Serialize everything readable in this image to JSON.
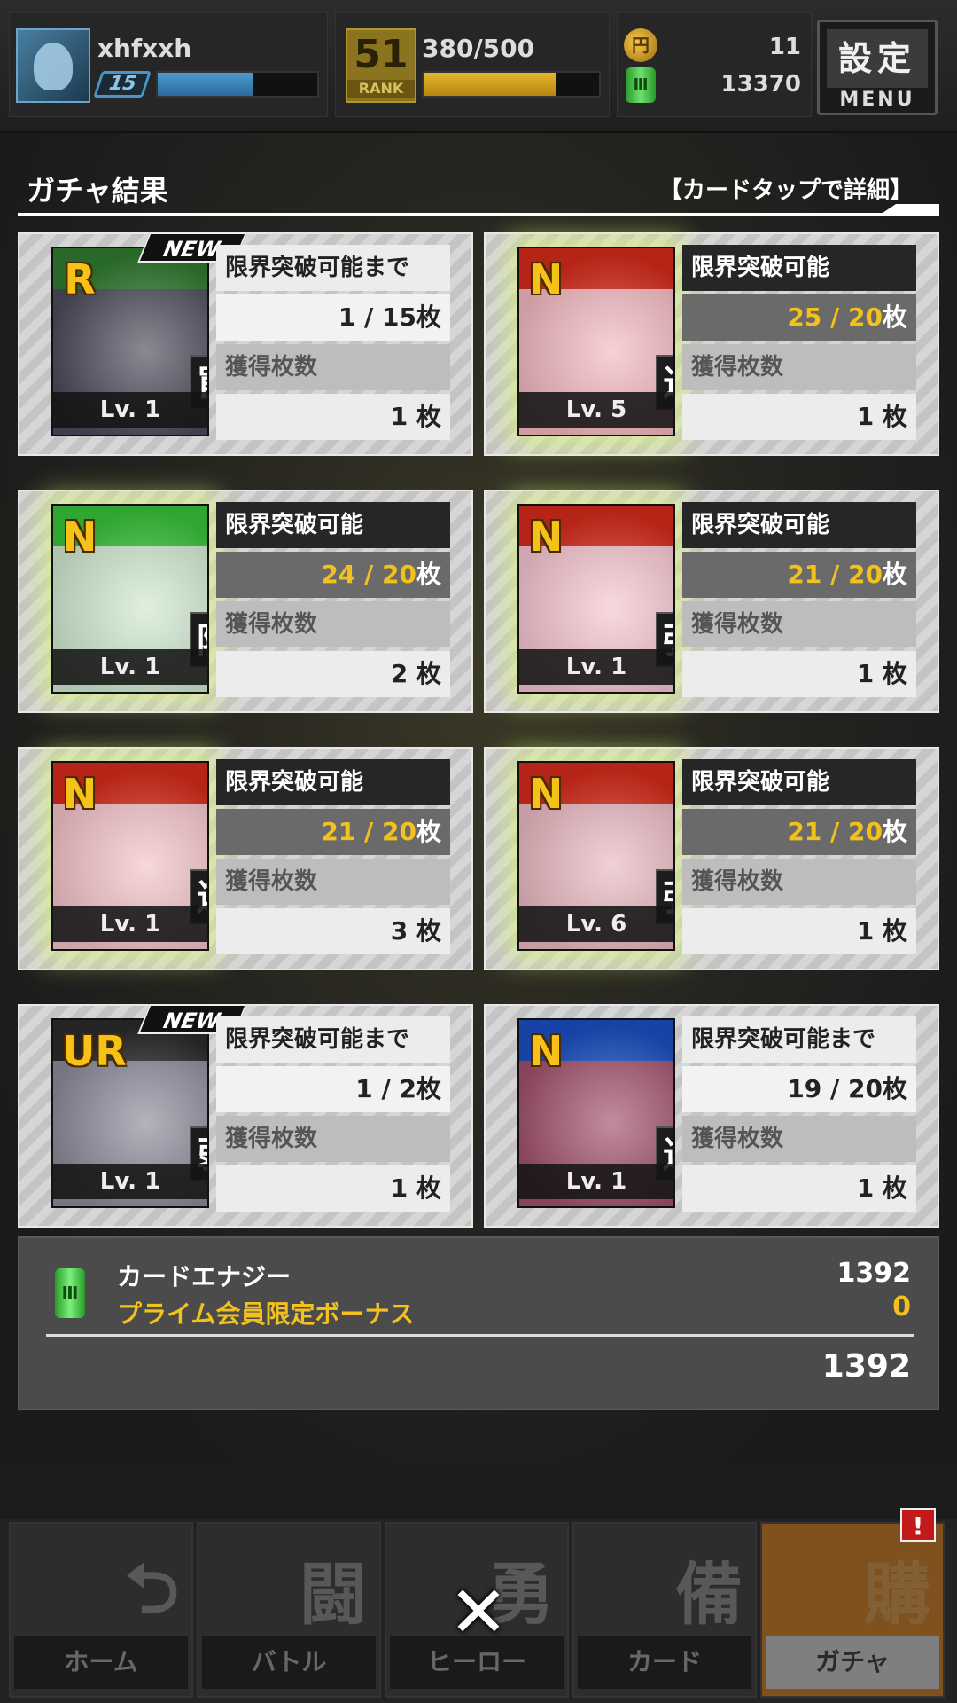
{
  "header": {
    "user_name": "xhfxxh",
    "user_level": "15",
    "exp_fill": 0.6,
    "rank_number": "51",
    "rank_label": "RANK",
    "rank_progress": "380/500",
    "rank_fill": 0.76,
    "coin_symbol": "円",
    "coins": "11",
    "energy_symbol": "Ⅲ",
    "energy": "13370",
    "settings_jp": "設定",
    "settings_en": "MENU"
  },
  "title": {
    "text": "ガチャ結果",
    "hint": "【カードタップで詳細】"
  },
  "cards": [
    {
      "rarity": "R",
      "is_new": true,
      "new_label": "NEW",
      "type": "罠",
      "level": "Lv. 1",
      "label1": "限界突破可能まで",
      "value1": "1 / 15",
      "unit1": "枚",
      "label2": "獲得枚数",
      "value2": "1",
      "unit2": "枚",
      "breakable": false,
      "frame_color": "#2f7a2f",
      "art_color": "#4a4a5a"
    },
    {
      "rarity": "N",
      "is_new": false,
      "new_label": "",
      "type": "近",
      "level": "Lv. 5",
      "label1": "限界突破可能",
      "value1": "25 / 20",
      "unit1": "枚",
      "label2": "獲得枚数",
      "value2": "1",
      "unit2": "枚",
      "breakable": true,
      "frame_color": "#d52a1a",
      "art_color": "#f2b8c0"
    },
    {
      "rarity": "N",
      "is_new": false,
      "new_label": "",
      "type": "防",
      "level": "Lv. 1",
      "label1": "限界突破可能",
      "value1": "24 / 20",
      "unit1": "枚",
      "label2": "獲得枚数",
      "value2": "2",
      "unit2": "枚",
      "breakable": true,
      "frame_color": "#3ac23a",
      "art_color": "#cfe8cf"
    },
    {
      "rarity": "N",
      "is_new": false,
      "new_label": "",
      "type": "強",
      "level": "Lv. 1",
      "label1": "限界突破可能",
      "value1": "21 / 20",
      "unit1": "枚",
      "label2": "獲得枚数",
      "value2": "1",
      "unit2": "枚",
      "breakable": true,
      "frame_color": "#d52a1a",
      "art_color": "#f5c4cf"
    },
    {
      "rarity": "N",
      "is_new": false,
      "new_label": "",
      "type": "連",
      "level": "Lv. 1",
      "label1": "限界突破可能",
      "value1": "21 / 20",
      "unit1": "枚",
      "label2": "獲得枚数",
      "value2": "3",
      "unit2": "枚",
      "breakable": true,
      "frame_color": "#d52a1a",
      "art_color": "#f2c2c8"
    },
    {
      "rarity": "N",
      "is_new": false,
      "new_label": "",
      "type": "強",
      "level": "Lv. 6",
      "label1": "限界突破可能",
      "value1": "21 / 20",
      "unit1": "枚",
      "label2": "獲得枚数",
      "value2": "1",
      "unit2": "枚",
      "breakable": true,
      "frame_color": "#d52a1a",
      "art_color": "#e8b8c0"
    },
    {
      "rarity": "UR",
      "is_new": true,
      "new_label": "NEW",
      "type": "弱",
      "level": "Lv. 1",
      "label1": "限界突破可能まで",
      "value1": "1 / 2",
      "unit1": "枚",
      "label2": "獲得枚数",
      "value2": "1",
      "unit2": "枚",
      "breakable": false,
      "frame_color": "#2a2a2a",
      "art_color": "#8a8a9a"
    },
    {
      "rarity": "N",
      "is_new": false,
      "new_label": "",
      "type": "連",
      "level": "Lv. 1",
      "label1": "限界突破可能まで",
      "value1": "19 / 20",
      "unit1": "枚",
      "label2": "獲得枚数",
      "value2": "1",
      "unit2": "枚",
      "breakable": false,
      "frame_color": "#1a4fc2",
      "art_color": "#a0506a"
    }
  ],
  "summary": {
    "icon_symbol": "Ⅲ",
    "label1": "カードエナジー",
    "value1": "1392",
    "label2": "プライム会員限定ボーナス",
    "value2": "0",
    "total": "1392"
  },
  "nav": [
    {
      "kanji": "⮌",
      "label": "ホーム",
      "active": false
    },
    {
      "kanji": "闘",
      "label": "バトル",
      "active": false
    },
    {
      "kanji": "勇",
      "label": "ヒーロー",
      "active": false
    },
    {
      "kanji": "備",
      "label": "カード",
      "active": false
    },
    {
      "kanji": "購",
      "label": "ガチャ",
      "active": true
    }
  ],
  "alert_symbol": "!",
  "close_symbol": "✕"
}
